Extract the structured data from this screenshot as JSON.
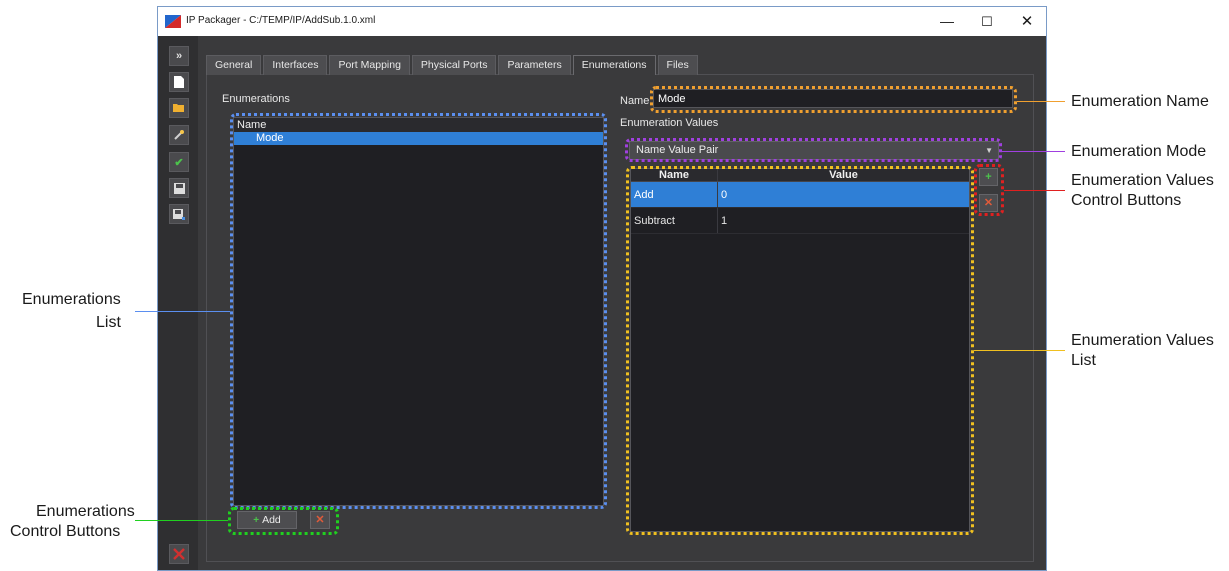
{
  "window": {
    "title": "IP Packager - C:/TEMP/IP/AddSub.1.0.xml",
    "minimize": "—",
    "maximize": "☐",
    "close": "✕"
  },
  "toolbar": {
    "icons": [
      "expand-icon",
      "new-file-icon",
      "open-folder-icon",
      "wand-icon",
      "check-icon",
      "save-icon",
      "save-as-icon",
      "exit-icon"
    ]
  },
  "tabs": [
    {
      "label": "General"
    },
    {
      "label": "Interfaces"
    },
    {
      "label": "Port Mapping"
    },
    {
      "label": "Physical Ports"
    },
    {
      "label": "Parameters"
    },
    {
      "label": "Enumerations",
      "active": true
    },
    {
      "label": "Files"
    }
  ],
  "enumerations": {
    "section_label": "Enumerations",
    "list_header": "Name",
    "items": [
      "Mode"
    ],
    "add_label": "Add",
    "add_icon": "+",
    "delete_icon": "✕"
  },
  "details": {
    "name_label": "Name",
    "name_value": "Mode",
    "values_label": "Enumeration Values",
    "mode_value": "Name Value Pair",
    "table": {
      "columns": [
        "Name",
        "Value"
      ],
      "rows": [
        {
          "name": "Add",
          "value": "0"
        },
        {
          "name": "Subtract",
          "value": "1"
        }
      ]
    },
    "add_value_icon": "+",
    "delete_value_icon": "✕"
  },
  "annotations": {
    "enum_name": "Enumeration Name",
    "enum_mode": "Enumeration Mode",
    "enum_values_ctrl_1": "Enumeration Values",
    "enum_values_ctrl_2": "Control Buttons",
    "enum_values_list_1": "Enumeration Values",
    "enum_values_list_2": "List",
    "enum_list_1": "Enumerations",
    "enum_list_2": "List",
    "enum_ctrl_1": "Enumerations",
    "enum_ctrl_2": "Control Buttons"
  },
  "colors": {
    "callout_blue": "#5b8ff0",
    "callout_orange": "#f0a030",
    "callout_purple": "#a040e0",
    "callout_yellow": "#f0c020",
    "callout_red": "#e02020",
    "callout_green": "#20d020",
    "selection": "#2f7fd6"
  }
}
